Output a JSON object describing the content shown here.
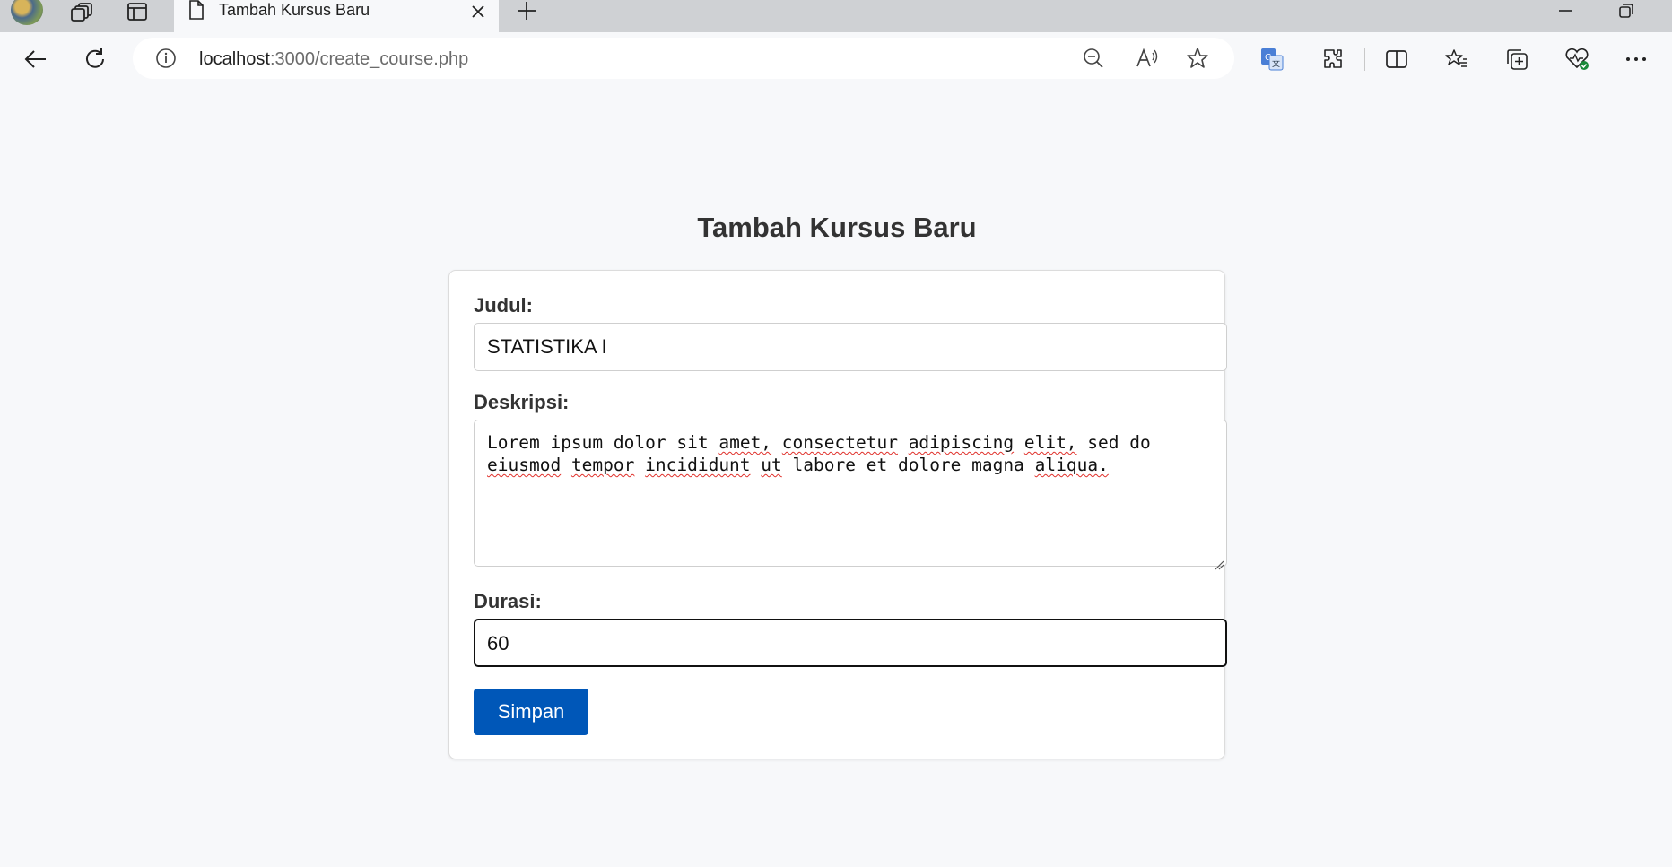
{
  "browser": {
    "tab_title": "Tambah Kursus Baru",
    "url_host": "localhost",
    "url_path": ":3000/create_course.php"
  },
  "page": {
    "heading": "Tambah Kursus Baru"
  },
  "form": {
    "title_label": "Judul:",
    "title_value": "STATISTIKA I",
    "description_label": "Deskripsi:",
    "description_words": [
      "Lorem",
      "ipsum",
      "dolor",
      "sit",
      "amet,",
      "consectetur",
      "adipiscing",
      "elit,",
      "sed",
      "do",
      "eiusmod",
      "tempor",
      "incididunt",
      "ut",
      "labore",
      "et",
      "dolore",
      "magna",
      "aliqua."
    ],
    "duration_label": "Durasi:",
    "duration_value": "60",
    "submit_label": "Simpan"
  },
  "colors": {
    "submit_bg": "#0057b8",
    "spellcheck_underline": "#e0302a"
  }
}
